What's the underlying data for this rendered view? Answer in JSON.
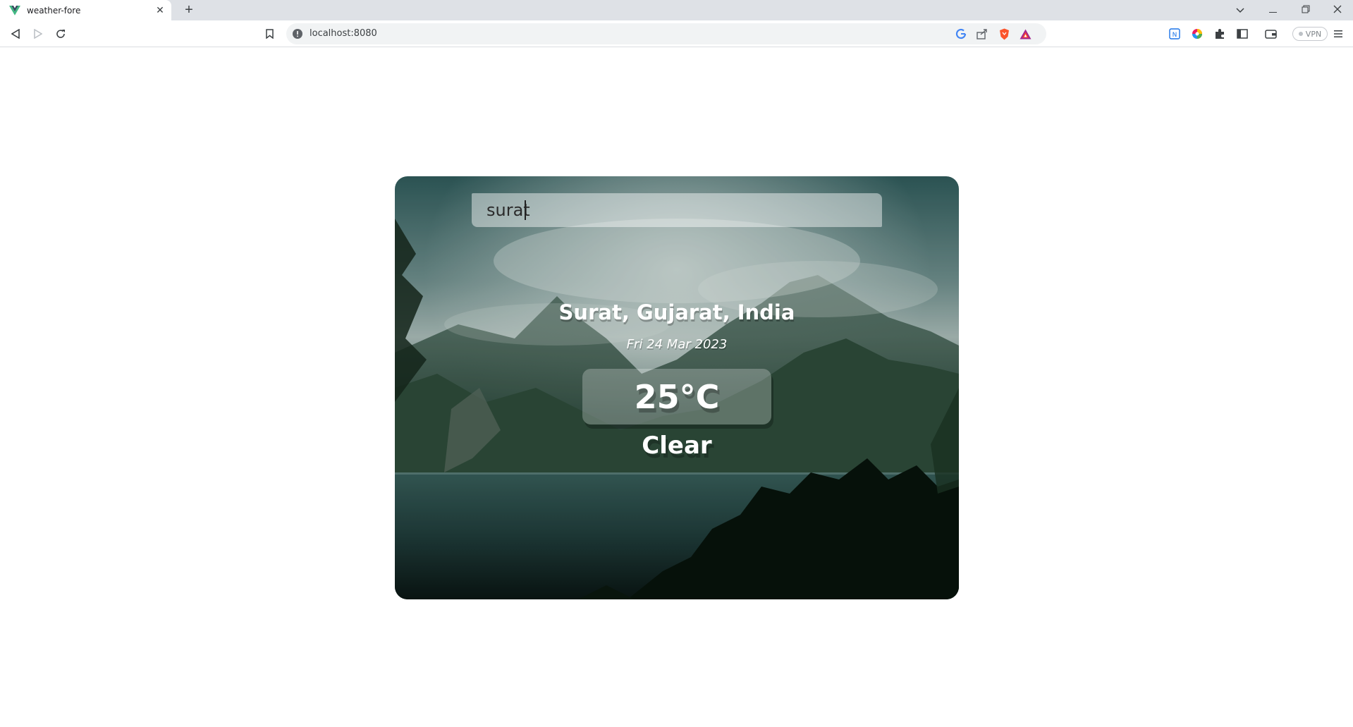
{
  "browser": {
    "tab_title": "weather-fore",
    "new_tab_symbol": "+",
    "url": "localhost:8080",
    "vpn_label": "VPN",
    "window_controls": [
      "minimize-icon",
      "restore-icon",
      "close-icon"
    ]
  },
  "app": {
    "search": {
      "value": "surat",
      "placeholder": ""
    },
    "location": "Surat, Gujarat, India",
    "date": "Fri 24 Mar 2023",
    "temperature": "25°C",
    "weather": "Clear"
  },
  "colors": {
    "tabbar": "#dee1e6",
    "brave_orange": "#fb542b",
    "vue_green": "#42b883"
  }
}
